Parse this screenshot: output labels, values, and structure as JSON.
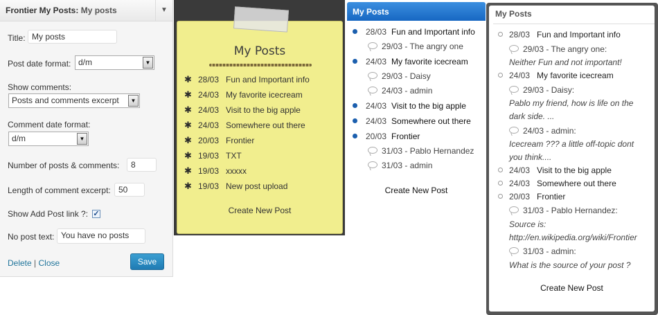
{
  "settings": {
    "header_title": "Frontier My Posts:",
    "header_subtitle": "My posts",
    "toggle_glyph": "▼",
    "title_label": "Title:",
    "title_value": "My posts",
    "post_date_label": "Post date format:",
    "post_date_value": "d/m",
    "show_comments_label": "Show comments:",
    "show_comments_value": "Posts and comments excerpt",
    "comment_date_label": "Comment date format:",
    "comment_date_value": "d/m",
    "num_posts_label": "Number of posts & comments:",
    "num_posts_value": "8",
    "excerpt_len_label": "Length of comment excerpt:",
    "excerpt_len_value": "50",
    "show_add_label": "Show Add Post link ?:",
    "show_add_checked": true,
    "no_post_label": "No post text:",
    "no_post_value": "You have no posts",
    "delete_link": "Delete",
    "separator": "|",
    "close_link": "Close",
    "save_button": "Save"
  },
  "sticky": {
    "title": "My Posts",
    "items": [
      {
        "date": "28/03",
        "title": "Fun and Important info"
      },
      {
        "date": "24/03",
        "title": "My favorite icecream"
      },
      {
        "date": "24/03",
        "title": "Visit to the big apple"
      },
      {
        "date": "24/03",
        "title": "Somewhere out there"
      },
      {
        "date": "20/03",
        "title": "Frontier"
      },
      {
        "date": "19/03",
        "title": "TXT"
      },
      {
        "date": "19/03",
        "title": "xxxxx"
      },
      {
        "date": "19/03",
        "title": "New post upload"
      }
    ],
    "create_link": "Create New Post"
  },
  "blue": {
    "title": "My Posts",
    "post1": {
      "date": "28/03",
      "title": "Fun and Important info"
    },
    "post1_c1": "29/03 - The angry one",
    "post2": {
      "date": "24/03",
      "title": "My favorite icecream"
    },
    "post2_c1": "29/03 - Daisy",
    "post2_c2": "24/03 - admin",
    "post3": {
      "date": "24/03",
      "title": "Visit to the big apple"
    },
    "post4": {
      "date": "24/03",
      "title": "Somewhere out there"
    },
    "post5": {
      "date": "20/03",
      "title": "Frontier"
    },
    "post5_c1": "31/03 - Pablo Hernandez",
    "post5_c2": "31/03 - admin",
    "create_link": "Create New Post"
  },
  "grey": {
    "title": "My Posts",
    "post1": {
      "date": "28/03",
      "title": "Fun and Important info"
    },
    "post1_c1": "29/03 - The angry one:",
    "post1_c1_ex": "Neither Fun and not important!",
    "post2": {
      "date": "24/03",
      "title": "My favorite icecream"
    },
    "post2_c1": "29/03 - Daisy:",
    "post2_c1_ex1": "Pablo my friend, how is life on the",
    "post2_c1_ex2": "dark side. ...",
    "post2_c2": "24/03 - admin:",
    "post2_c2_ex1": "Icecream ??? a little off-topic dont",
    "post2_c2_ex2": "you think....",
    "post3": {
      "date": "24/03",
      "title": "Visit to the big apple"
    },
    "post4": {
      "date": "24/03",
      "title": "Somewhere out there"
    },
    "post5": {
      "date": "20/03",
      "title": "Frontier"
    },
    "post5_c1": "31/03 - Pablo Hernandez:",
    "post5_c1_ex1": "Source is:",
    "post5_c1_ex2": "http://en.wikipedia.org/wiki/Frontier",
    "post5_c2": "31/03 - admin:",
    "post5_c2_ex": "What is the source of your post ?",
    "create_link": "Create New Post"
  },
  "colors": {
    "accent_blue": "#1767c2",
    "note_yellow": "#f1ee8e",
    "save_button": "#2a8bc6",
    "link": "#21759b"
  }
}
